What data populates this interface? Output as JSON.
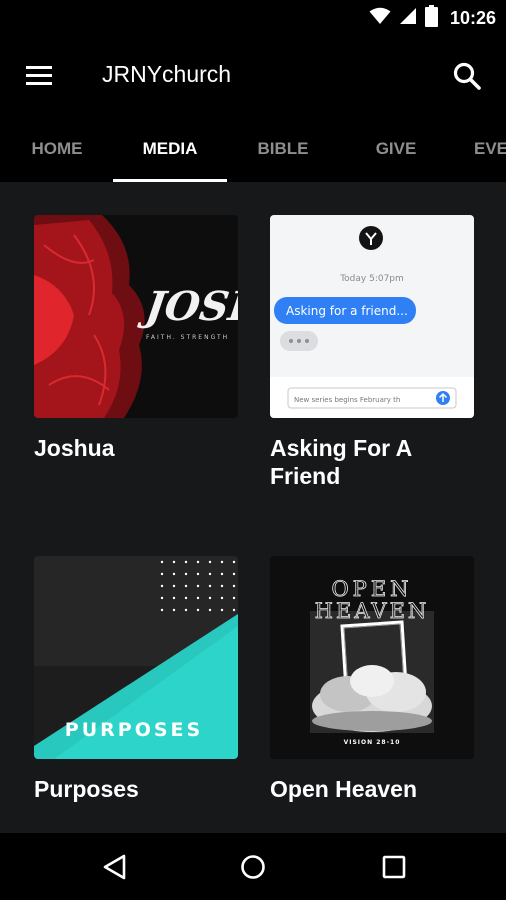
{
  "status_bar": {
    "time": "10:26",
    "icons": [
      "wifi-icon",
      "signal-icon",
      "battery-icon"
    ]
  },
  "app_bar": {
    "title": "JRNYchurch",
    "menu_icon": "hamburger-menu-icon",
    "search_icon": "search-icon"
  },
  "tabs": [
    {
      "label": "HOME",
      "active": false
    },
    {
      "label": "MEDIA",
      "active": true
    },
    {
      "label": "BIBLE",
      "active": false
    },
    {
      "label": "GIVE",
      "active": false
    },
    {
      "label": "EVE",
      "active": false
    }
  ],
  "media_items": [
    {
      "title": "Joshua",
      "artwork": {
        "headline": "JOSH",
        "subline": "FAITH. STRENGTH",
        "colors": {
          "lion": "#b3141c",
          "bg": "#0d0d0d"
        }
      }
    },
    {
      "title": "Asking For A Friend",
      "artwork": {
        "timestamp": "Today 5:07pm",
        "bubble_text": "Asking for a friend...",
        "input_text": "New series begins February th",
        "colors": {
          "bubble": "#2f80f5",
          "bg": "#f4f5f7"
        }
      }
    },
    {
      "title": "Purposes",
      "artwork": {
        "banner_text": "PURPOSES",
        "colors": {
          "accent": "#2dd4c9",
          "bg": "#1a1a1a"
        }
      }
    },
    {
      "title": "Open Heaven",
      "artwork": {
        "line1": "OPEN",
        "line2": "HEAVEN",
        "verse": "VISION 28-10",
        "colors": {
          "bg": "#0e0e0e"
        }
      }
    }
  ],
  "nav_bar": {
    "icons": [
      "back-triangle-icon",
      "home-circle-icon",
      "recents-square-icon"
    ]
  },
  "colors": {
    "background": "#16181a",
    "bars": "#000000",
    "inactive_tab": "#8e8e8e",
    "active_tab": "#ffffff"
  }
}
